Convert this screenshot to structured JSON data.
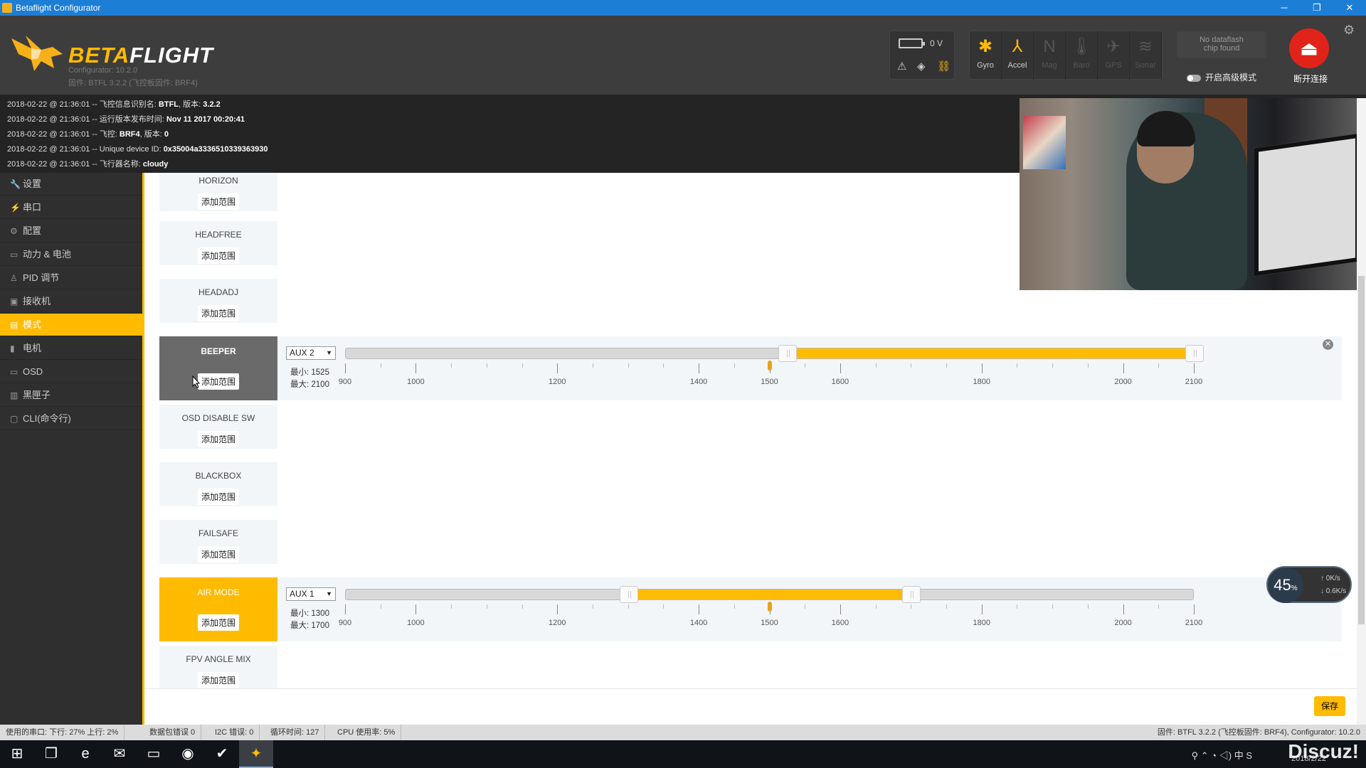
{
  "window": {
    "title": "Betaflight Configurator",
    "min": "─",
    "max": "❐",
    "close": "✕"
  },
  "header": {
    "logo": "BETAFLIGHT",
    "configurator_version": "Configurator: 10.2.0",
    "firmware": "固件: BTFL 3.2.2 (飞控板固件: BRF4)",
    "battery_voltage": "0 V",
    "sensors": [
      {
        "name": "Gyro",
        "icon": "gyro-icon",
        "glyph": "✱",
        "active": true
      },
      {
        "name": "Accel",
        "icon": "accel-icon",
        "glyph": "⅄",
        "active": true
      },
      {
        "name": "Mag",
        "icon": "mag-icon",
        "glyph": "N",
        "active": false
      },
      {
        "name": "Baro",
        "icon": "baro-icon",
        "glyph": "🌡",
        "active": false
      },
      {
        "name": "GPS",
        "icon": "gps-icon",
        "glyph": "✈",
        "active": false
      },
      {
        "name": "Sonar",
        "icon": "sonar-icon",
        "glyph": "≋",
        "active": false
      }
    ],
    "dataflash_line1": "No dataflash",
    "dataflash_line2": "chip found",
    "expert_mode": "开启高级模式",
    "disconnect": "断开连接"
  },
  "log": [
    {
      "prefix": "2018-02-22 @ 21:36:01 -- 飞控信息识别名: ",
      "bold": "BTFL",
      "mid": ", 版本: ",
      "bold2": "3.2.2"
    },
    {
      "prefix": "2018-02-22 @ 21:36:01 -- 运行版本发布时间: ",
      "bold": "Nov 11 2017 00:20:41",
      "mid": "",
      "bold2": ""
    },
    {
      "prefix": "2018-02-22 @ 21:36:01 -- 飞控: ",
      "bold": "BRF4",
      "mid": ", 版本: ",
      "bold2": "0"
    },
    {
      "prefix": "2018-02-22 @ 21:36:01 -- Unique device ID: ",
      "bold": "0x35004a3336510339363930",
      "mid": "",
      "bold2": ""
    },
    {
      "prefix": "2018-02-22 @ 21:36:01 -- 飞行器名称: ",
      "bold": "cloudy",
      "mid": "",
      "bold2": ""
    }
  ],
  "sidebar": {
    "items": [
      {
        "label": "设置",
        "icon": "wrench-icon",
        "glyph": "🔧"
      },
      {
        "label": "串口",
        "icon": "plug-icon",
        "glyph": "⚡"
      },
      {
        "label": "配置",
        "icon": "gear-icon",
        "glyph": "⚙"
      },
      {
        "label": "动力 & 电池",
        "icon": "battery-icon",
        "glyph": "▭"
      },
      {
        "label": "PID 调节",
        "icon": "pid-icon",
        "glyph": "♙"
      },
      {
        "label": "接收机",
        "icon": "receiver-icon",
        "glyph": "▣"
      },
      {
        "label": "模式",
        "icon": "modes-icon",
        "glyph": "▤"
      },
      {
        "label": "电机",
        "icon": "motor-icon",
        "glyph": "▮"
      },
      {
        "label": "OSD",
        "icon": "osd-icon",
        "glyph": "▭"
      },
      {
        "label": "黑匣子",
        "icon": "blackbox-icon",
        "glyph": "▥"
      },
      {
        "label": "CLI(命令行)",
        "icon": "cli-icon",
        "glyph": "▢"
      }
    ],
    "active_index": 6
  },
  "modes": {
    "add_range_label": "添加范围",
    "items": [
      {
        "name": "HORIZON"
      },
      {
        "name": "HEADFREE"
      },
      {
        "name": "HEADADJ"
      },
      {
        "name": "BEEPER"
      },
      {
        "name": "OSD DISABLE SW"
      },
      {
        "name": "BLACKBOX"
      },
      {
        "name": "FAILSAFE"
      },
      {
        "name": "AIR MODE"
      },
      {
        "name": "FPV ANGLE MIX"
      }
    ],
    "ranges": [
      {
        "mode": "BEEPER",
        "channel": "AUX 2",
        "min_label": "最小: 1525",
        "max_label": "最大: 2100",
        "min": 1525,
        "max": 2100,
        "current": 1500
      },
      {
        "mode": "AIR MODE",
        "channel": "AUX 1",
        "min_label": "最小: 1300",
        "max_label": "最大: 1700",
        "min": 1300,
        "max": 1700,
        "current": 1500
      }
    ],
    "scale": {
      "min": 900,
      "max": 2100,
      "labels": [
        "900",
        "1000",
        "1200",
        "1400",
        "1500",
        "1600",
        "1800",
        "2000",
        "2100"
      ]
    }
  },
  "save_label": "保存",
  "net_widget": {
    "percent": "45",
    "percent_unit": "%",
    "up": "0K/s",
    "down": "0.6K/s"
  },
  "status_bar": {
    "port_usage": "使用的串口: 下行: 27% 上行: 2%",
    "packet_errors": "数据包错误 0",
    "i2c_errors": "I2C 错误: 0",
    "cycle_time": "循环时间: 127",
    "cpu_load": "CPU 使用率: 5%",
    "versions": "固件: BTFL 3.2.2 (飞控板固件: BRF4), Configurator: 10.2.0"
  },
  "taskbar": {
    "apps": [
      {
        "name": "start-icon",
        "glyph": "⊞"
      },
      {
        "name": "task-view-icon",
        "glyph": "❐"
      },
      {
        "name": "edge-icon",
        "glyph": "e"
      },
      {
        "name": "mail-icon",
        "glyph": "✉"
      },
      {
        "name": "explorer-icon",
        "glyph": "▭"
      },
      {
        "name": "qq-icon",
        "glyph": "◉"
      },
      {
        "name": "app-icon",
        "glyph": "✔"
      },
      {
        "name": "betaflight-task-icon",
        "glyph": "✦"
      }
    ],
    "tray": "⚲ ⌃ ◔ ◁) 中 S",
    "clock": "2018/2/22",
    "watermark": "Discuz!"
  },
  "colors": {
    "accent": "#ffbb00",
    "title_bar": "#1d7ed6",
    "disconnect": "#e2231a"
  }
}
